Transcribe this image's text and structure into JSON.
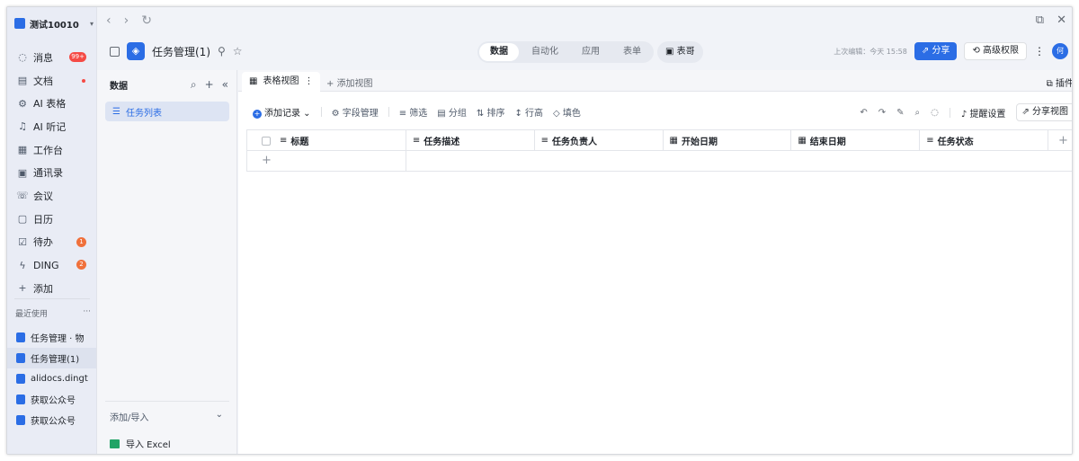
{
  "org": {
    "name": "测试10010",
    "caret": "▾"
  },
  "nav": {
    "items": [
      {
        "icon": "◌",
        "label": "消息",
        "badge": "99+"
      },
      {
        "icon": "▤",
        "label": "文档",
        "dot": true
      },
      {
        "icon": "⚙",
        "label": "AI 表格"
      },
      {
        "icon": "♫",
        "label": "AI 听记"
      },
      {
        "icon": "▦",
        "label": "工作台"
      },
      {
        "icon": "▣",
        "label": "通讯录"
      },
      {
        "icon": "☏",
        "label": "会议"
      },
      {
        "icon": "▢",
        "label": "日历"
      },
      {
        "icon": "☑",
        "label": "待办",
        "badge": "1"
      },
      {
        "icon": "ϟ",
        "label": "DING",
        "badge": "2"
      },
      {
        "icon": "+",
        "label": "添加"
      }
    ],
    "recent_title": "最近使用",
    "recent_more": "···",
    "recent": [
      {
        "label": "任务管理 · 物"
      },
      {
        "label": "任务管理(1)"
      },
      {
        "label": "alidocs.dingt"
      },
      {
        "label": "获取公众号"
      },
      {
        "label": "获取公众号"
      }
    ]
  },
  "topbar": {
    "back": "‹",
    "forward": "›",
    "refresh": "↻",
    "restore": "⧉",
    "close": "✕"
  },
  "doc": {
    "title": "任务管理(1)",
    "tabs": [
      "数据",
      "自动化",
      "应用",
      "表单"
    ],
    "active_tab": "数据",
    "biaoge": "表哥",
    "last_edit": "上次编辑：今天 15:58",
    "share": "分享",
    "permission": "高级权限",
    "more": "⋮",
    "avatar": "何"
  },
  "data_panel": {
    "title": "数据",
    "table_name": "任务列表",
    "add_import": "添加/导入",
    "import_excel": "导入 Excel"
  },
  "main": {
    "view_tab": "表格视图",
    "add_view": "添加视图",
    "plugin": "插件",
    "toolbar": {
      "add_record": "添加记录",
      "fields": "字段管理",
      "filter": "筛选",
      "group": "分组",
      "sort": "排序",
      "row_height": "行高",
      "fill": "填色",
      "remind": "提醒设置",
      "share_view": "分享视图"
    },
    "columns": [
      {
        "label": "标题",
        "icon": "≡"
      },
      {
        "label": "任务描述",
        "icon": "≡"
      },
      {
        "label": "任务负责人",
        "icon": "≡"
      },
      {
        "label": "开始日期",
        "icon": "▦"
      },
      {
        "label": "结束日期",
        "icon": "▦"
      },
      {
        "label": "任务状态",
        "icon": "≡"
      }
    ],
    "add_row": "+",
    "add_column": "+"
  }
}
